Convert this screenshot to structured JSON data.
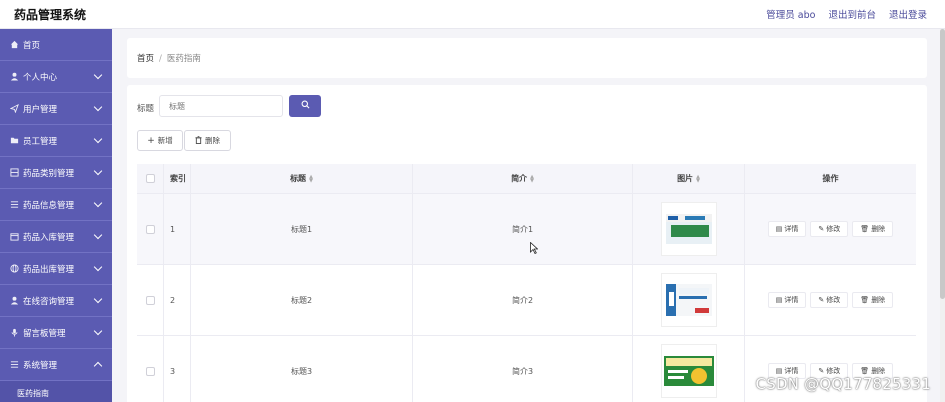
{
  "header": {
    "app_title": "药品管理系统",
    "links": [
      "管理员 abo",
      "退出到前台",
      "退出登录"
    ]
  },
  "sidebar": {
    "items": [
      {
        "label": "首页",
        "icon": "home-icon",
        "expandable": false
      },
      {
        "label": "个人中心",
        "icon": "user-icon",
        "expandable": true
      },
      {
        "label": "用户管理",
        "icon": "send-icon",
        "expandable": true
      },
      {
        "label": "员工管理",
        "icon": "folder-icon",
        "expandable": true
      },
      {
        "label": "药品类别管理",
        "icon": "grid-icon",
        "expandable": true
      },
      {
        "label": "药品信息管理",
        "icon": "list-icon",
        "expandable": true
      },
      {
        "label": "药品入库管理",
        "icon": "box-icon",
        "expandable": true
      },
      {
        "label": "药品出库管理",
        "icon": "globe-icon",
        "expandable": true
      },
      {
        "label": "在线咨询管理",
        "icon": "user-icon",
        "expandable": true
      },
      {
        "label": "留言板管理",
        "icon": "mic-icon",
        "expandable": true
      },
      {
        "label": "系统管理",
        "icon": "menu-icon",
        "expandable": true,
        "expanded": true
      }
    ],
    "sub_item": "医药指南"
  },
  "breadcrumb": {
    "home": "首页",
    "separator": "/",
    "current": "医药指南"
  },
  "search": {
    "label": "标题",
    "placeholder": "标题"
  },
  "toolbar": {
    "add_label": "新增",
    "delete_label": "删除"
  },
  "table": {
    "headers": {
      "index": "索引",
      "title": "标题",
      "intro": "简介",
      "image": "图片",
      "ops": "操作"
    },
    "rows": [
      {
        "index": "1",
        "title": "标题1",
        "intro": "简介1"
      },
      {
        "index": "2",
        "title": "标题2",
        "intro": "简介2"
      },
      {
        "index": "3",
        "title": "标题3",
        "intro": "简介3"
      }
    ],
    "ops": {
      "detail": "详情",
      "edit": "修改",
      "delete": "删除"
    }
  },
  "thumbnails": [
    {
      "label": "盐酸洛贝液",
      "color": "#2a7a3a"
    },
    {
      "label": "清咽灵消炎颗",
      "color": "#2a6fb0"
    },
    {
      "label": "小儿消积止咳口服液",
      "color": "#2a8a3a"
    }
  ],
  "watermark": "CSDN @QQ177825331",
  "colors": {
    "accent": "#5b5bb2",
    "sidebar": "#5b5bb2"
  }
}
